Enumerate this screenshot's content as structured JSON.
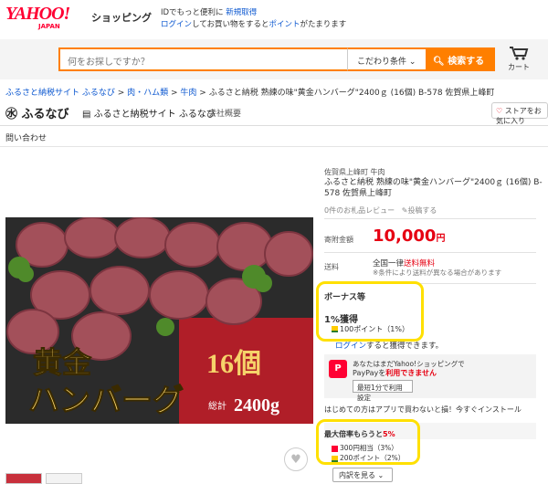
{
  "header": {
    "logo_text": "YAHOO!",
    "logo_sub": "JAPAN",
    "service": "ショッピング",
    "promo_line1_prefix": "IDでもっと便利に ",
    "promo_line1_link": "新規取得",
    "promo_line2_link1": "ログイン",
    "promo_line2_mid": "してお買い物をすると",
    "promo_line2_link2": "ポイント",
    "promo_line2_suffix": "がたまります"
  },
  "search": {
    "placeholder": "何をお探しですか？",
    "condition_label": "こだわり条件",
    "button_label": "検索する",
    "cart_label": "カート"
  },
  "breadcrumb": {
    "items": [
      "ふるさと納税サイト ふるなび",
      "肉・ハム類",
      "牛肉"
    ],
    "current": "ふるさと納税 熟練の味\"黄金ハンバーグ\"2400ｇ (16個) B-578 佐賀県上峰町"
  },
  "store": {
    "logo": "ふるなび",
    "name": "ふるさと納税サイト ふるなび",
    "overview": "会社概要",
    "follow": "ストアをお気に入り",
    "contact": "問い合わせ"
  },
  "product": {
    "category": "佐賀県上峰町 牛肉",
    "title": "ふるさと納税 熟練の味\"黄金ハンバーグ\"2400ｇ (16個) B-578 佐賀県上峰町",
    "reviews": "0件のお札品レビュー",
    "question": "投稿する",
    "image_text_main": "黄金\nハンバーグ",
    "image_text_count": "16個",
    "image_text_total": "総計",
    "image_text_weight": "2400g"
  },
  "price": {
    "label": "寄附金額",
    "value": "10,000",
    "unit": "円"
  },
  "shipping": {
    "label": "送料",
    "line1_prefix": "全国一律",
    "line1_red": "送料無料",
    "line2": "※条件により送料が異なる場合があります"
  },
  "bonus": {
    "heading": "ボーナス等",
    "earn": "1%獲得",
    "points": "100ポイント（1%）",
    "login_link": "ログイン",
    "login_suffix": "すると獲得できます。"
  },
  "paypay": {
    "line1": "あなたはまだYahoo!ショッピングで",
    "line2_prefix": "PayPayを",
    "line2_red": "利用できません",
    "button": "最短1分で利用設定",
    "icon": "P"
  },
  "app_message": "はじめての方はアプリで買わないと損！今すぐインストール",
  "max_bonus": {
    "heading_prefix": "最大倍率もらうと",
    "heading_red": "5%",
    "row1": "300円相当（3%）",
    "row2": "200ポイント（2%）",
    "breakdown": "内訳を見る"
  },
  "colors": {
    "accent": "#ff7f00",
    "price_red": "#e60012",
    "highlight": "#ffe000",
    "link": "#0b57d0"
  }
}
